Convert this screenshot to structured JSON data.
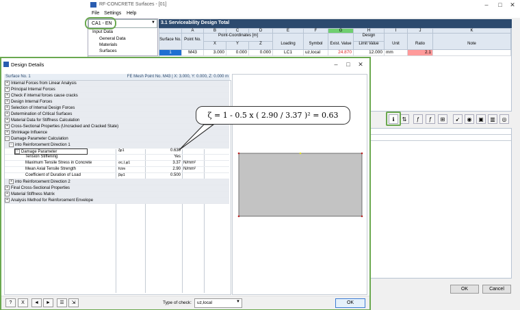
{
  "main_window": {
    "title": "RF-CONCRETE Surfaces - [01]",
    "menu": [
      "File",
      "Settings",
      "Help"
    ],
    "case_combo": "CA1 - EN",
    "tree": [
      "Input Data",
      "General Data",
      "Materials",
      "Surfaces"
    ],
    "panel_title": "3.1 Serviceability Design Total",
    "columns": {
      "letters": [
        "A",
        "B",
        "C",
        "D",
        "E",
        "F",
        "G",
        "H",
        "I",
        "J",
        "K"
      ],
      "surface_no": "Surface No.",
      "point_no": "Point No.",
      "point_coords": "Point-Coordinates [m]",
      "x": "X",
      "y": "Y",
      "z": "Z",
      "loading": "Loading",
      "symbol": "Symbol",
      "exist_value": "Exist. Value",
      "design": "Design",
      "limit_value": "Limit Value",
      "unit": "Unit",
      "ratio": "Ratio",
      "note": "Note"
    },
    "row": {
      "surface": "1",
      "point": "M43",
      "x": "3.000",
      "y": "0.000",
      "z": "0.000",
      "loading": "LC1",
      "symbol": "uz,local",
      "exist": "24.870",
      "limit": "12.000",
      "unit": "mm",
      "ratio": "2.1"
    },
    "ok": "OK",
    "cancel": "Cancel"
  },
  "dialog": {
    "title": "Design Details",
    "surface_label": "Surface No. 1",
    "fe_point": "FE Mesh Point No. M43  |  X: 3.000, Y: 0.000, Z: 0.000 m",
    "rows": [
      {
        "label": "Internal Forces from Linear Analysis"
      },
      {
        "label": "Principal Internal Forces"
      },
      {
        "label": "Check if internal forces cause cracks"
      },
      {
        "label": "Design Internal Forces"
      },
      {
        "label": "Selection of Internal Design Forces"
      },
      {
        "label": "Determination of Critical Surfaces"
      },
      {
        "label": "Material Data for Stiffness Calculation"
      },
      {
        "label": "Cross-Sectional Properties (Uncracked and Cracked State)"
      },
      {
        "label": "Shrinkage Influence"
      },
      {
        "label": "Damage Parameter Calculation"
      },
      {
        "label": "into Reinforcement Direction 1"
      },
      {
        "label": "Damage Parameter",
        "symbol": "ζφ1",
        "value": "0.630",
        "unit": ""
      },
      {
        "label": "Tension Stiffening",
        "symbol": "",
        "value": "Yes",
        "unit": ""
      },
      {
        "label": "Maximum Tensile Stress in Concrete",
        "symbol": "σc,I,φ1",
        "value": "3.37",
        "unit": "N/mm²"
      },
      {
        "label": "Mean Axial Tensile Strength",
        "symbol": "fctm",
        "value": "2.90",
        "unit": "N/mm²"
      },
      {
        "label": "Coefficient of Duration of Load",
        "symbol": "βφ1",
        "value": "0.500",
        "unit": ""
      },
      {
        "label": "into Reinforcement Direction 2"
      },
      {
        "label": "Final Cross-Sectional Properties"
      },
      {
        "label": "Material Stiffness Matrix"
      },
      {
        "label": "Analysis Method for Reinforcement Envelope"
      }
    ],
    "type_of_check_label": "Type of check:",
    "type_of_check_value": "uz,local",
    "ok": "OK"
  },
  "callout": "ζ = 1 - 0.5 x ( 2.90 / 3.37 )² = 0.63",
  "colors": {
    "accent_green": "#6aa84f",
    "header_blue": "#2c4a6e",
    "highlight_red": "#ff9a9a"
  }
}
